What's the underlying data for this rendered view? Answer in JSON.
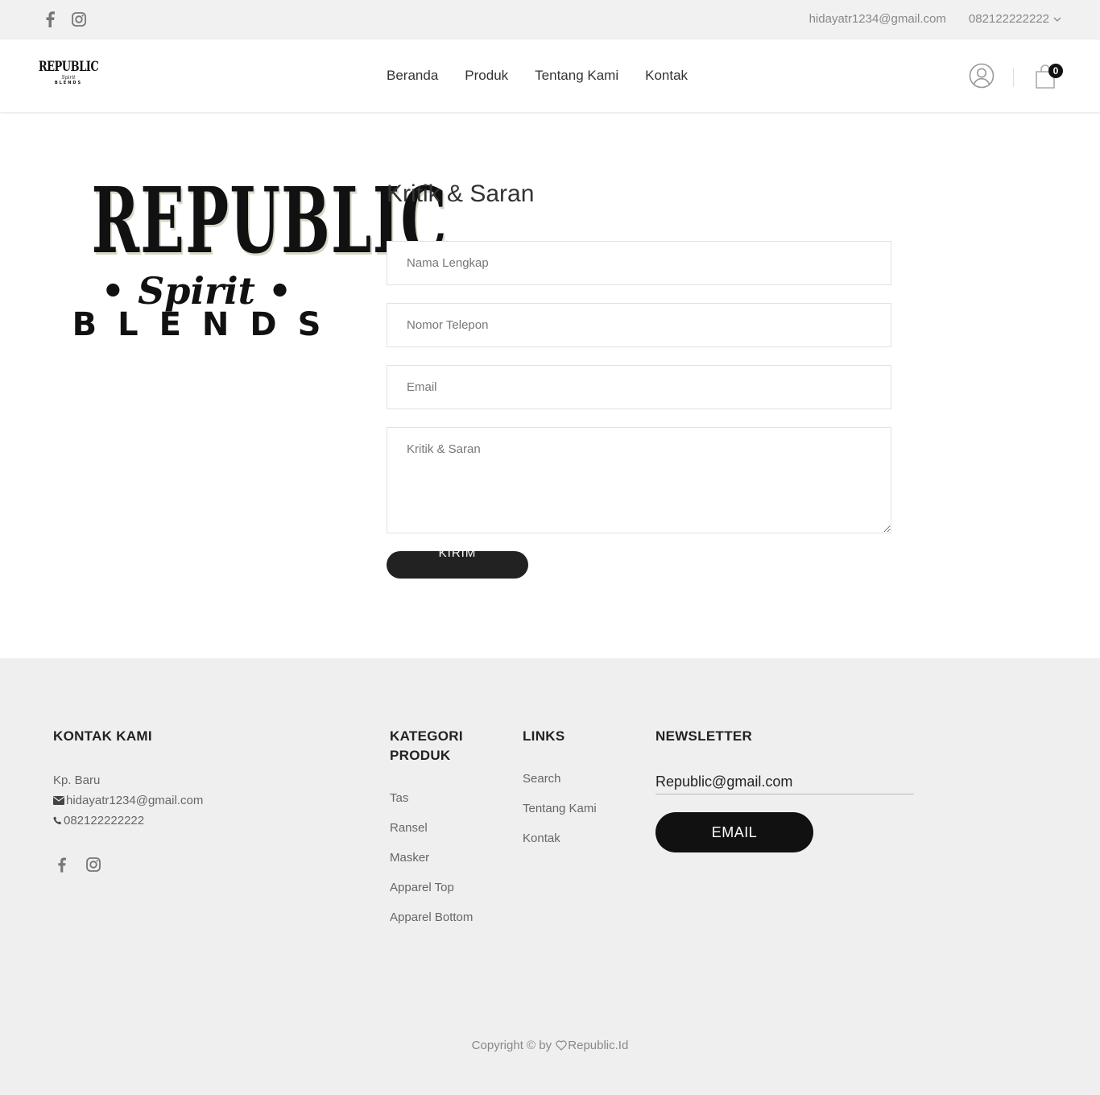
{
  "topbar": {
    "email": "hidayatr1234@gmail.com",
    "phone": "082122222222",
    "social_icons": [
      "facebook-icon",
      "instagram-icon"
    ]
  },
  "header": {
    "logo": {
      "line1": "REPUBLIC",
      "line2": "Spirit",
      "line3": "BLENDS"
    },
    "nav": [
      "Beranda",
      "Produk",
      "Tentang Kami",
      "Kontak"
    ],
    "cart_count": "0"
  },
  "hero_logo": {
    "word": "REPUBLIC",
    "spirit": "• Spirit •",
    "blends": "BLENDS"
  },
  "form": {
    "title": "Kritik & Saran",
    "name_placeholder": "Nama Lengkap",
    "phone_placeholder": "Nomor Telepon",
    "email_placeholder": "Email",
    "message_placeholder": "Kritik & Saran",
    "submit_label": "KIRIM"
  },
  "footer": {
    "contact": {
      "title": "KONTAK KAMI",
      "address": "Kp. Baru",
      "email": "hidayatr1234@gmail.com",
      "phone": "082122222222"
    },
    "categories": {
      "title": "KATEGORI PRODUK",
      "items": [
        "Tas",
        "Ransel",
        "Masker",
        "Apparel Top",
        "Apparel Bottom"
      ]
    },
    "links": {
      "title": "LINKS",
      "items": [
        "Search",
        "Tentang Kami",
        "Kontak"
      ]
    },
    "newsletter": {
      "title": "NEWSLETTER",
      "input_value": "Republic@gmail.com",
      "button_label": "EMAIL"
    },
    "copyright_prefix": "Copyright © by ",
    "copyright_brand": "Republic.Id"
  },
  "colors": {
    "dark": "#111111",
    "topbar_bg": "#f1f1f1",
    "footer_bg": "#efefef"
  }
}
